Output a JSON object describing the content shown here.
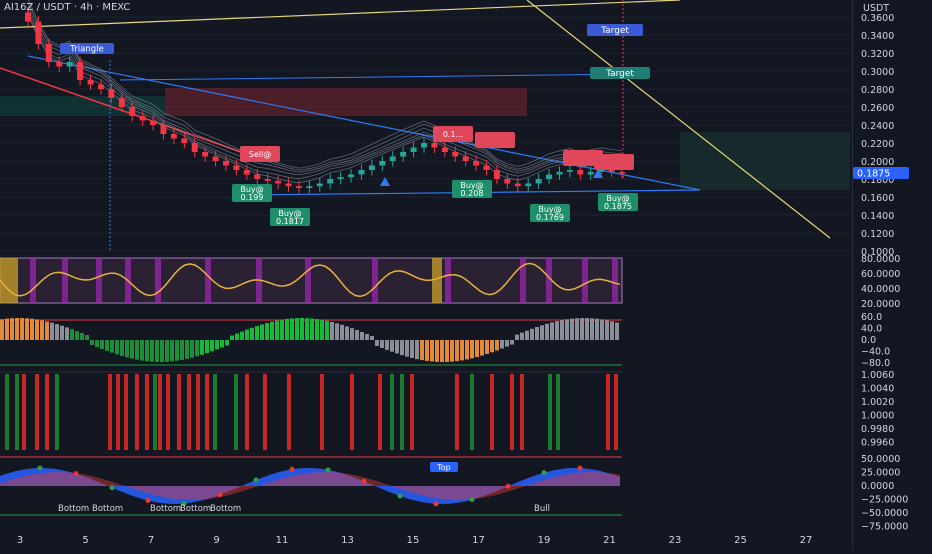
{
  "header": {
    "title": "AI16Z / USDT · 4h · MEXC",
    "currency": "USDT",
    "last_price": "0.1875"
  },
  "colors": {
    "background": "#131722",
    "bull": "#26a69a",
    "bear": "#ef5350",
    "pink_bear": "#f23645",
    "blue_label": "#2962ff",
    "yellow_line": "#e6d77a",
    "osc_band": "#a57cbd",
    "axis_text": "#d1d4dc"
  },
  "price_axis": [
    "0.3600",
    "0.3400",
    "0.3200",
    "0.3000",
    "0.2800",
    "0.2600",
    "0.2400",
    "0.2200",
    "0.2000",
    "0.1800",
    "0.1600",
    "0.1400",
    "0.1200",
    "0.1000"
  ],
  "rsi_axis": [
    "80.0000",
    "60.0000",
    "40.0000",
    "20.0000"
  ],
  "macd_axis": [
    "60.0",
    "40.0",
    "0.0",
    "−40.0",
    "−80.0"
  ],
  "ratio_axis": [
    "1.0060",
    "1.0040",
    "1.0020",
    "1.0000",
    "0.9980",
    "0.9960"
  ],
  "wave_axis": [
    "50.0000",
    "25.0000",
    "0.0000",
    "−25.0000",
    "−50.0000",
    "−75.0000"
  ],
  "time_axis": [
    "3",
    "5",
    "7",
    "9",
    "11",
    "13",
    "15",
    "17",
    "19",
    "21",
    "23",
    "25",
    "27"
  ],
  "labels": {
    "target_1": "Target",
    "target_2": "Target",
    "triangle": "Triangle",
    "sell_1": "Sell@",
    "sell_1_price": "0.1..."
  },
  "chart_data": {
    "type": "candlestick",
    "symbol": "AI16Z / USDT",
    "interval": "4h",
    "exchange": "MEXC",
    "ylim": [
      0.1,
      0.36
    ],
    "close_series": [
      0.355,
      0.33,
      0.31,
      0.305,
      0.31,
      0.29,
      0.285,
      0.28,
      0.27,
      0.26,
      0.25,
      0.245,
      0.24,
      0.23,
      0.225,
      0.22,
      0.21,
      0.205,
      0.2,
      0.195,
      0.19,
      0.185,
      0.18,
      0.178,
      0.175,
      0.172,
      0.17,
      0.172,
      0.175,
      0.18,
      0.182,
      0.185,
      0.19,
      0.195,
      0.2,
      0.205,
      0.21,
      0.215,
      0.22,
      0.215,
      0.21,
      0.205,
      0.2,
      0.195,
      0.19,
      0.18,
      0.175,
      0.172,
      0.175,
      0.18,
      0.185,
      0.188,
      0.19,
      0.185,
      0.188,
      0.19,
      0.188,
      0.187
    ],
    "annotations": [
      {
        "text": "Buy@",
        "price": "0.199"
      },
      {
        "text": "Buy@",
        "price": "0.1817"
      },
      {
        "text": "Buy@",
        "price": "0.208"
      },
      {
        "text": "Buy@",
        "price": "0.1769"
      },
      {
        "text": "Buy@",
        "price": "0.1875"
      }
    ],
    "oscillator_range": [
      20,
      80
    ],
    "macd_range": [
      -80,
      60
    ],
    "ratio_range": [
      0.996,
      1.006
    ],
    "wave_range": [
      -75,
      50
    ],
    "wave_labels": [
      "Bottom",
      "Bottom",
      "Bottom",
      "Bottom",
      "Bottom",
      "Top",
      "Bull"
    ]
  }
}
